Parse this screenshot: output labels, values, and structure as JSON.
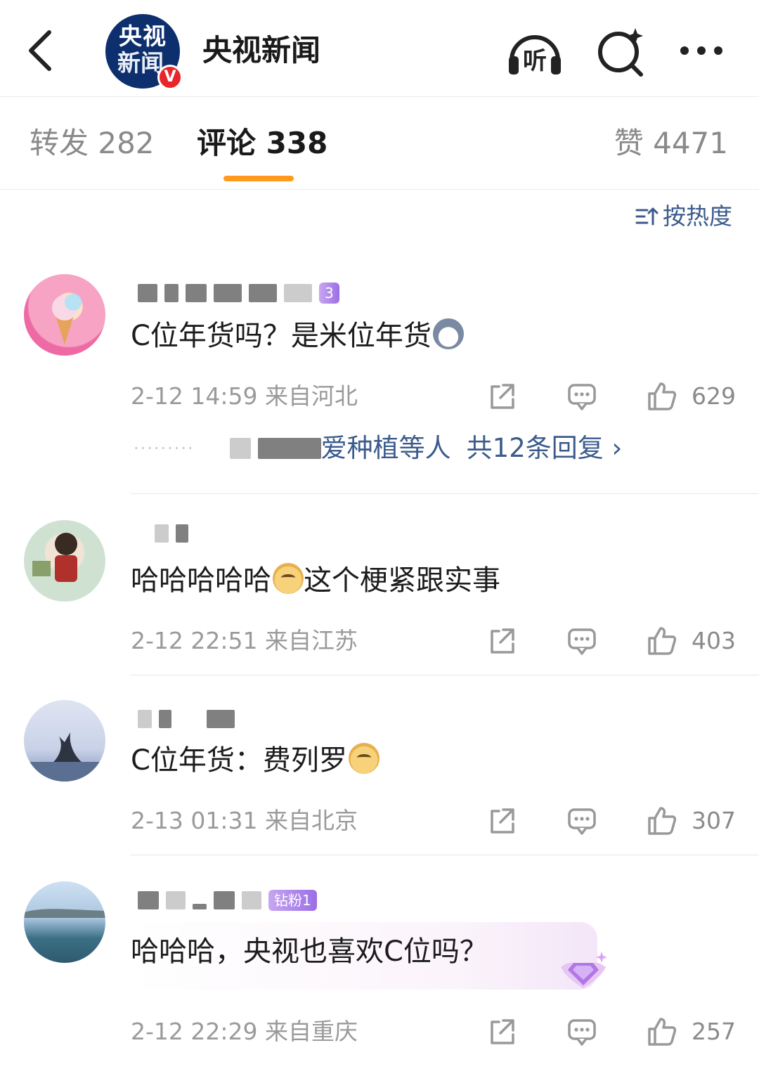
{
  "header": {
    "title": "央视新闻",
    "logo_line1": "央视",
    "logo_line2": "新闻",
    "verified_mark": "V",
    "listen_label": "听"
  },
  "tabs": {
    "repost": "转发 282",
    "comments": "评论 338",
    "likes": "赞 4471",
    "active": "comments",
    "accent_color": "#ff9a1e"
  },
  "sort": {
    "label": "按热度"
  },
  "comments": [
    {
      "badge": "3",
      "text": "C位年货吗？是米位年货",
      "emoji": "husky-emoji",
      "meta": "2-12 14:59  来自河北",
      "likes": "629",
      "replies_preview": "爱种植等人",
      "replies_link": "共12条回复 ›"
    },
    {
      "text": "哈哈哈哈哈",
      "emoji": "doge-emoji",
      "text_after": "这个梗紧跟实事",
      "meta": "2-12 22:51  来自江苏",
      "likes": "403"
    },
    {
      "text": "C位年货：费列罗",
      "emoji": "doge-emoji",
      "meta": "2-13 01:31  来自北京",
      "likes": "307"
    },
    {
      "badge": "钻粉1",
      "text": "哈哈哈，央视也喜欢C位吗？",
      "meta": "2-12 22:29  来自重庆",
      "likes": "257"
    }
  ],
  "colors": {
    "link_blue": "#3b5b8c",
    "meta_gray": "#9a9a9a",
    "brand_navy": "#0d2f6e",
    "verified_red": "#e8262a"
  }
}
